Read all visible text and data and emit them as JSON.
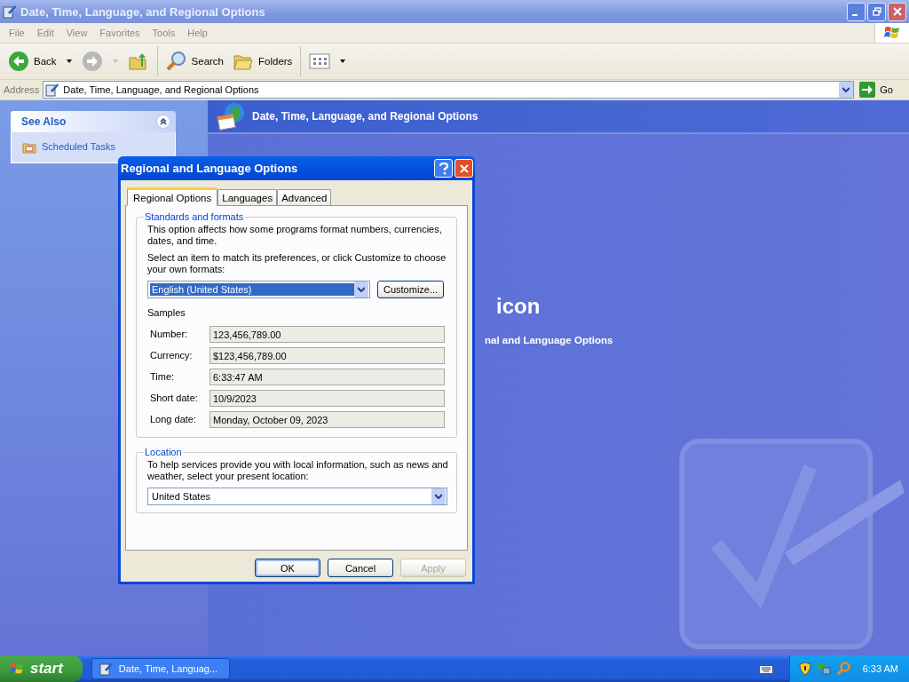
{
  "window": {
    "title": "Date, Time, Language, and Regional Options"
  },
  "menu": [
    "File",
    "Edit",
    "View",
    "Favorites",
    "Tools",
    "Help"
  ],
  "toolbar": {
    "back": "Back",
    "search": "Search",
    "folders": "Folders"
  },
  "address": {
    "label": "Address",
    "value": "Date, Time, Language, and Regional Options",
    "go": "Go"
  },
  "see_also": {
    "title": "See Also",
    "items": [
      "Scheduled Tasks"
    ]
  },
  "header": {
    "title": "Date, Time, Language, and Regional Options"
  },
  "background_texts": [
    {
      "kind": "heading",
      "text": "icon"
    },
    {
      "kind": "link",
      "text": "nal and Language Options"
    }
  ],
  "dialog": {
    "title": "Regional and Language Options",
    "tabs": [
      {
        "label": "Regional Options",
        "selected": true
      },
      {
        "label": "Languages",
        "selected": false
      },
      {
        "label": "Advanced",
        "selected": false
      }
    ],
    "standards": {
      "legend": "Standards and formats",
      "description": "This option affects how some programs format numbers, currencies, dates, and time.",
      "instruction": "Select an item to match its preferences, or click Customize to choose your own formats:",
      "format": "English (United States)",
      "customize": "Customize...",
      "samples_label": "Samples",
      "samples": [
        {
          "label": "Number:",
          "value": "123,456,789.00"
        },
        {
          "label": "Currency:",
          "value": "$123,456,789.00"
        },
        {
          "label": "Time:",
          "value": "6:33:47 AM"
        },
        {
          "label": "Short date:",
          "value": "10/9/2023"
        },
        {
          "label": "Long date:",
          "value": "Monday, October 09, 2023"
        }
      ]
    },
    "location": {
      "legend": "Location",
      "description": "To help services provide you with local information, such as news and weather, select your present location:",
      "value": "United States"
    },
    "buttons": [
      {
        "label": "OK",
        "default": true,
        "disabled": false
      },
      {
        "label": "Cancel",
        "default": false,
        "disabled": false
      },
      {
        "label": "Apply",
        "default": false,
        "disabled": true
      }
    ]
  },
  "taskbar": {
    "start": "start",
    "tasks": [
      {
        "label": "Date, Time, Languag...",
        "selected": false
      }
    ],
    "clock": "6:33 AM"
  }
}
